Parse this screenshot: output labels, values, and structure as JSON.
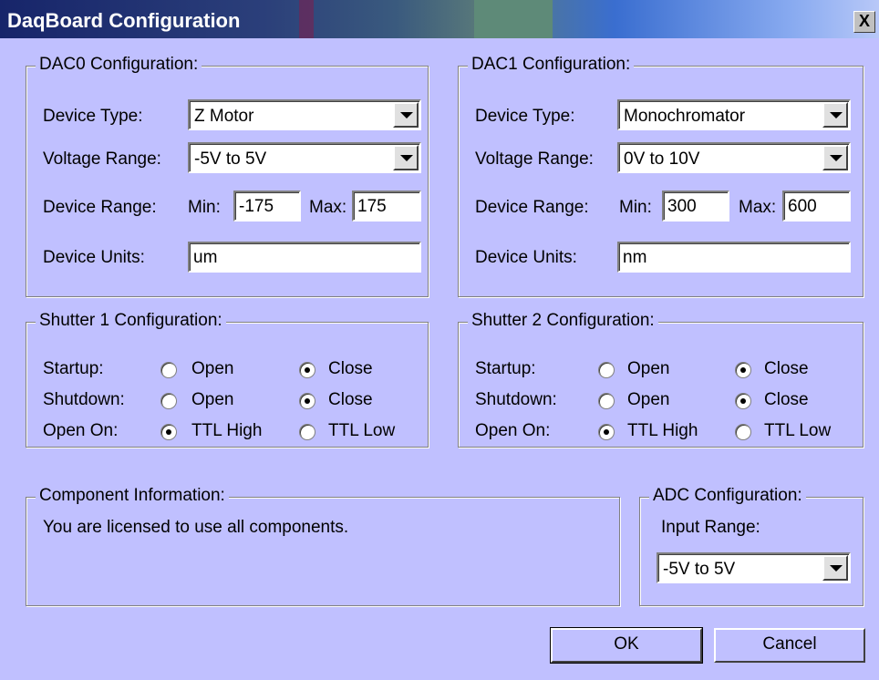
{
  "window": {
    "title": "DaqBoard Configuration",
    "close_label": "X"
  },
  "dac0": {
    "legend": "DAC0 Configuration:",
    "device_type_label": "Device Type:",
    "device_type_value": "Z Motor",
    "voltage_range_label": "Voltage Range:",
    "voltage_range_value": "-5V to 5V",
    "device_range_label": "Device Range:",
    "min_label": "Min:",
    "min_value": "-175",
    "max_label": "Max:",
    "max_value": "175",
    "device_units_label": "Device Units:",
    "device_units_value": "um"
  },
  "dac1": {
    "legend": "DAC1 Configuration:",
    "device_type_label": "Device Type:",
    "device_type_value": "Monochromator",
    "voltage_range_label": "Voltage Range:",
    "voltage_range_value": "0V to 10V",
    "device_range_label": "Device Range:",
    "min_label": "Min:",
    "min_value": "300",
    "max_label": "Max:",
    "max_value": "600",
    "device_units_label": "Device Units:",
    "device_units_value": "nm"
  },
  "shutter1": {
    "legend": "Shutter 1 Configuration:",
    "startup_label": "Startup:",
    "shutdown_label": "Shutdown:",
    "open_on_label": "Open On:",
    "open_label": "Open",
    "close_label": "Close",
    "ttl_high_label": "TTL High",
    "ttl_low_label": "TTL Low",
    "startup_selected": "Close",
    "shutdown_selected": "Close",
    "open_on_selected": "TTL High"
  },
  "shutter2": {
    "legend": "Shutter 2 Configuration:",
    "startup_label": "Startup:",
    "shutdown_label": "Shutdown:",
    "open_on_label": "Open On:",
    "open_label": "Open",
    "close_label": "Close",
    "ttl_high_label": "TTL High",
    "ttl_low_label": "TTL Low",
    "startup_selected": "Close",
    "shutdown_selected": "Close",
    "open_on_selected": "TTL High"
  },
  "component_info": {
    "legend": "Component Information:",
    "text": "You are licensed to use all components."
  },
  "adc": {
    "legend": "ADC Configuration:",
    "input_range_label": "Input Range:",
    "input_range_value": "-5V to 5V"
  },
  "buttons": {
    "ok": "OK",
    "cancel": "Cancel"
  },
  "colors": {
    "dialog_bg": "#c0c0ff",
    "titlebar_start": "#17256a",
    "titlebar_end": "#b8c8f8"
  }
}
